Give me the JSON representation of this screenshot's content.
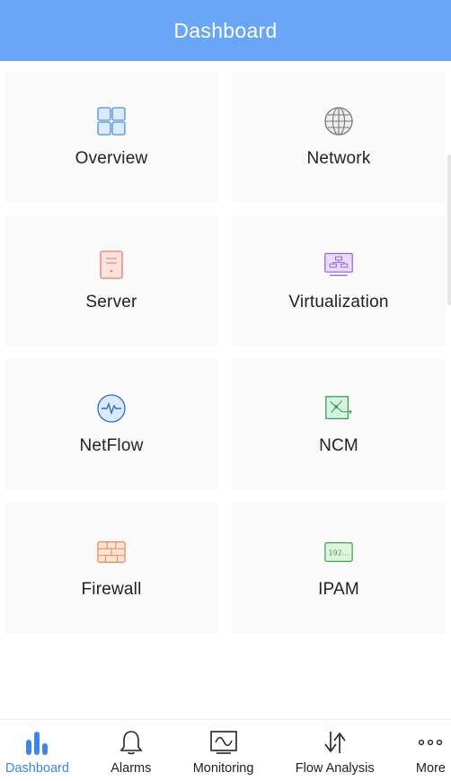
{
  "header": {
    "title": "Dashboard"
  },
  "tiles": [
    {
      "label": "Overview",
      "icon": "overview-grid-icon",
      "color": "#4a90d9"
    },
    {
      "label": "Network",
      "icon": "globe-icon",
      "color": "#777777"
    },
    {
      "label": "Server",
      "icon": "server-icon",
      "color": "#e57b6b"
    },
    {
      "label": "Virtualization",
      "icon": "virtualization-icon",
      "color": "#8e5bd6"
    },
    {
      "label": "NetFlow",
      "icon": "netflow-pulse-icon",
      "color": "#2f6fb8"
    },
    {
      "label": "NCM",
      "icon": "ncm-config-icon",
      "color": "#2e9e5b"
    },
    {
      "label": "Firewall",
      "icon": "firewall-brick-icon",
      "color": "#e8875a"
    },
    {
      "label": "IPAM",
      "icon": "ipam-icon",
      "color": "#3aa64a",
      "icon_text": "192..."
    }
  ],
  "tabbar": {
    "active": "Dashboard",
    "active_color": "#3d86e6",
    "items": [
      {
        "label": "Dashboard",
        "icon": "bar-chart-icon"
      },
      {
        "label": "Alarms",
        "icon": "bell-icon"
      },
      {
        "label": "Monitoring",
        "icon": "monitor-icon"
      },
      {
        "label": "Flow Analysis",
        "icon": "flow-arrows-icon"
      },
      {
        "label": "More",
        "icon": "more-dots-icon"
      }
    ]
  },
  "colors": {
    "header_bg": "#6aa6f7",
    "tile_bg": "#fafafa"
  }
}
